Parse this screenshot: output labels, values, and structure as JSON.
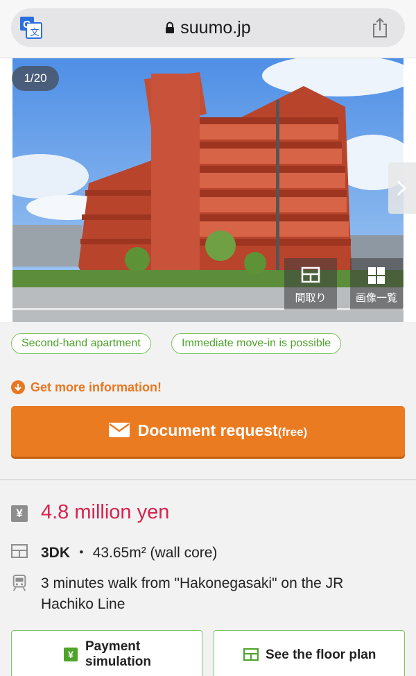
{
  "browser": {
    "url": "suumo.jp",
    "translate_icon": "translate-icon",
    "lock_icon": "lock-icon",
    "share_icon": "share-icon"
  },
  "gallery": {
    "counter": "1/20",
    "floor_plan_label": "間取り",
    "image_list_label": "画像一覧"
  },
  "tags": [
    "Second-hand apartment",
    "Immediate move-in is possible"
  ],
  "cta": {
    "more_info": "Get more information!",
    "document_request": "Document request",
    "free": "(free)"
  },
  "details": {
    "price": "4.8 million yen",
    "layout": "3DK",
    "area": "43.65m² (wall core)",
    "access": "3 minutes walk from \"Hakonegasaki\" on the JR Hachiko Line"
  },
  "actions": {
    "payment_line1": "Payment",
    "payment_line2": "simulation",
    "floor_plan": "See the floor plan"
  },
  "colors": {
    "accent_orange": "#ea7b21",
    "price_red": "#d6234f",
    "tag_green": "#4ea32a"
  }
}
